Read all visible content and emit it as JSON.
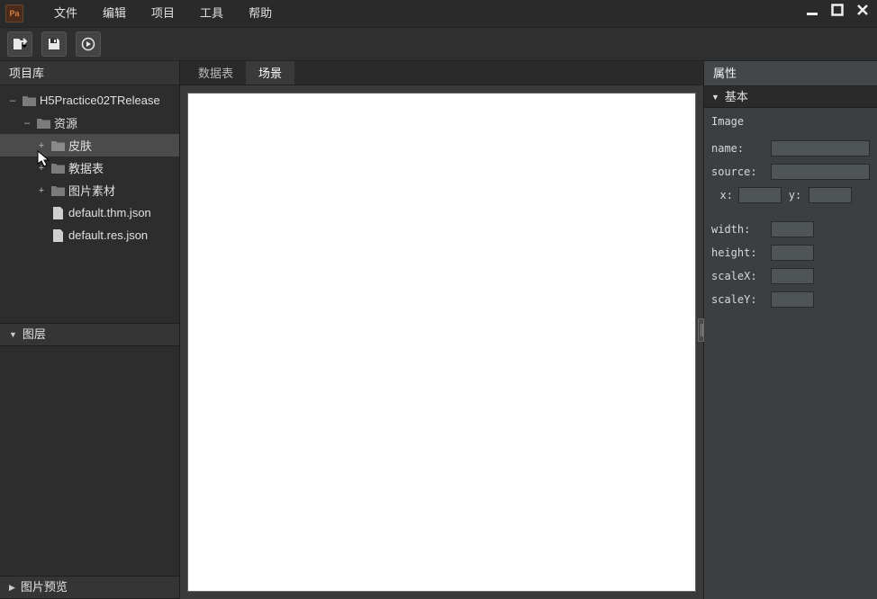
{
  "menu": {
    "file": "文件",
    "edit": "编辑",
    "project": "项目",
    "tools": "工具",
    "help": "帮助"
  },
  "left": {
    "project_lib": "项目库",
    "layers": "图层",
    "preview": "图片预览"
  },
  "tree": {
    "root": "H5Practice02TRelease",
    "resources": "资源",
    "skin": "皮肤",
    "datatable": "教据表",
    "imagemat": "图片素材",
    "file_thm": "default.thm.json",
    "file_res": "default.res.json"
  },
  "tabs": {
    "data": "数据表",
    "scene": "场景",
    "active": "scene"
  },
  "right": {
    "heading": "属性",
    "section_basic": "基本",
    "obj_type": "Image",
    "labels": {
      "name": "name:",
      "source": "source:",
      "x": "x:",
      "y": "y:",
      "width": "width:",
      "height": "height:",
      "scaleX": "scaleX:",
      "scaleY": "scaleY:"
    },
    "values": {
      "name": "",
      "source": "",
      "x": "",
      "y": "",
      "width": "",
      "height": "",
      "scaleX": "",
      "scaleY": ""
    }
  }
}
